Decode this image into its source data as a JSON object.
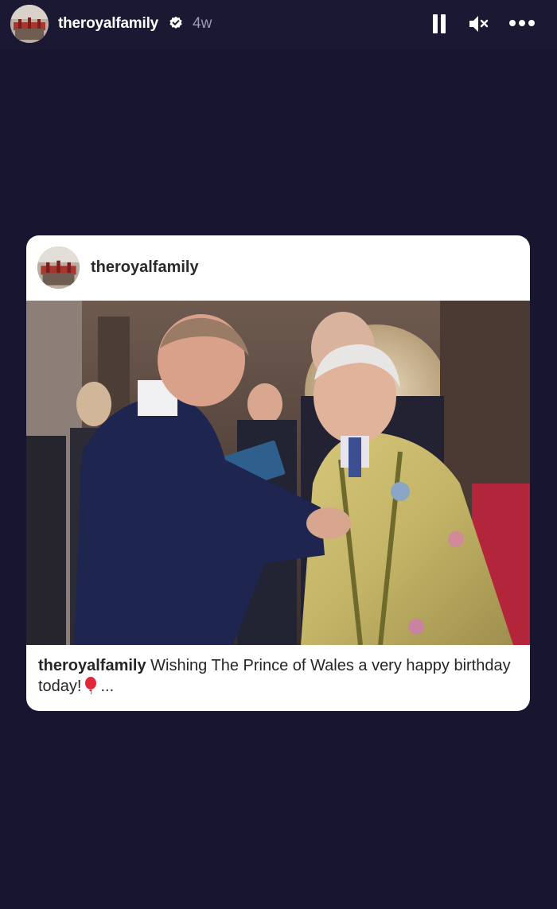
{
  "story": {
    "username": "theroyalfamily",
    "time": "4w"
  },
  "post": {
    "username": "theroyalfamily",
    "caption_user": "theroyalfamily",
    "caption_text": "Wishing The Prince of Wales a very happy birthday today!",
    "caption_more": "..."
  },
  "icons": {
    "verified": "verified-badge-icon",
    "pause": "pause-icon",
    "mute": "speaker-muted-icon",
    "more": "more-horizontal-icon",
    "balloon": "red-balloon-emoji"
  },
  "colors": {
    "background": "#17152f",
    "card": "#ffffff",
    "verified_badge": "#ffffff",
    "time_text": "#9e9cb0"
  }
}
